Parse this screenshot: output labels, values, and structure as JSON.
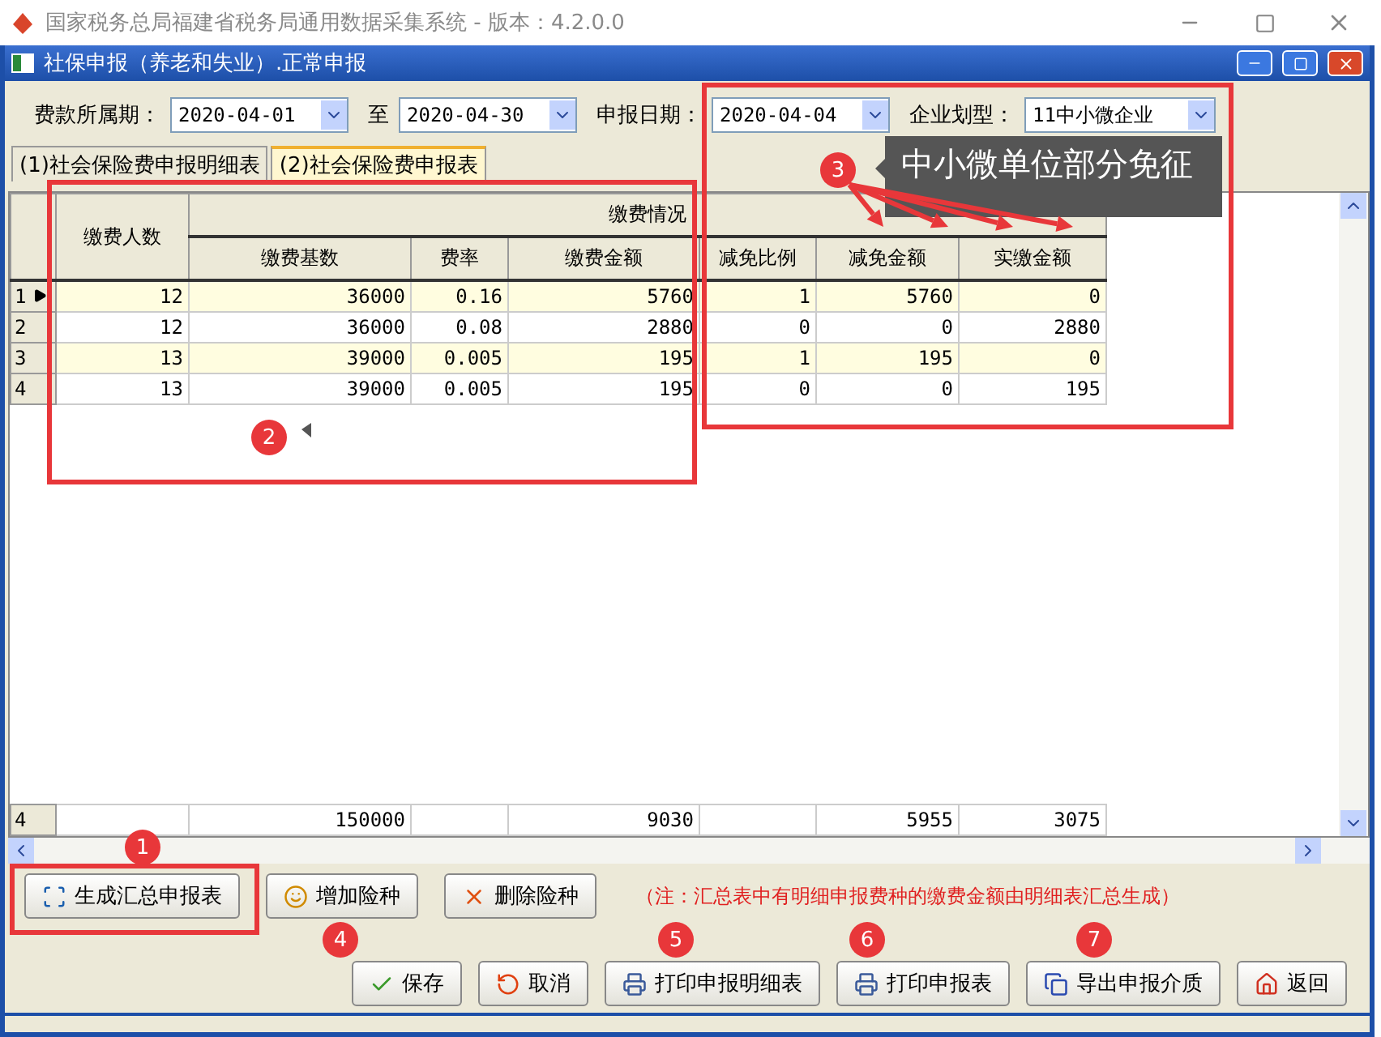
{
  "app_window": {
    "title": "国家税务总局福建省税务局通用数据采集系统 - 版本：4.2.0.0"
  },
  "dialog": {
    "title": "社保申报（养老和失业）.正常申报"
  },
  "filters": [
    {
      "label": "费款所属期：",
      "value": "2020-04-01"
    },
    {
      "label": "至",
      "value": "2020-04-30"
    },
    {
      "label": "申报日期：",
      "value": "2020-04-04"
    },
    {
      "label": "企业划型：",
      "value": "11中小微企业"
    }
  ],
  "tabs": [
    {
      "label": "(1)社会保险费申报明细表",
      "selected": false
    },
    {
      "label": "(2)社会保险费申报表",
      "selected": true
    }
  ],
  "table": {
    "group_header": "缴费情况",
    "columns": [
      "缴费人数",
      "缴费基数",
      "费率",
      "缴费金额",
      "减免比例",
      "减免金额",
      "实缴金额"
    ],
    "rows": [
      {
        "row_header": "1",
        "current": true,
        "cells": [
          "12",
          "36000",
          "0.16",
          "5760",
          "1",
          "5760",
          "0"
        ]
      },
      {
        "row_header": "2",
        "current": false,
        "cells": [
          "12",
          "36000",
          "0.08",
          "2880",
          "0",
          "0",
          "2880"
        ]
      },
      {
        "row_header": "3",
        "current": false,
        "cells": [
          "13",
          "39000",
          "0.005",
          "195",
          "1",
          "195",
          "0"
        ]
      },
      {
        "row_header": "4",
        "current": false,
        "cells": [
          "13",
          "39000",
          "0.005",
          "195",
          "0",
          "0",
          "195"
        ]
      }
    ],
    "totals": {
      "row_header": "4",
      "cells": [
        "",
        "150000",
        "",
        "9030",
        "",
        "5955",
        "3075"
      ]
    }
  },
  "actions": [
    "生成汇总申报表",
    "增加险种",
    "删除险种"
  ],
  "note": "（注：汇总表中有明细申报费种的缴费金额由明细表汇总生成）",
  "bottom_buttons": [
    "保存",
    "取消",
    "打印申报明细表",
    "打印申报表",
    "导出申报介质",
    "返回"
  ],
  "annotations": {
    "markers": [
      "1",
      "2",
      "3",
      "4",
      "5",
      "6",
      "7"
    ],
    "callout": "中小微单位部分免征"
  }
}
